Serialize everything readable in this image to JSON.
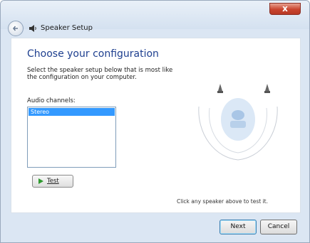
{
  "window": {
    "title": "Speaker Setup",
    "close_label": "x"
  },
  "page": {
    "heading": "Choose your configuration",
    "description": "Select the speaker setup below that is most like the configuration on your computer.",
    "channels_label": "Audio channels:",
    "channels": [
      "Stereo"
    ],
    "selected_channel": "Stereo",
    "test_label": "Test",
    "hint": "Click any speaker above to test it."
  },
  "buttons": {
    "next": "Next",
    "cancel": "Cancel"
  },
  "colors": {
    "heading": "#1e3f8f",
    "selection": "#3399ff",
    "close": "#c9452f"
  },
  "icons": [
    "back-arrow-icon",
    "speaker-setup-icon",
    "play-icon",
    "speaker-icon",
    "listener-icon"
  ]
}
